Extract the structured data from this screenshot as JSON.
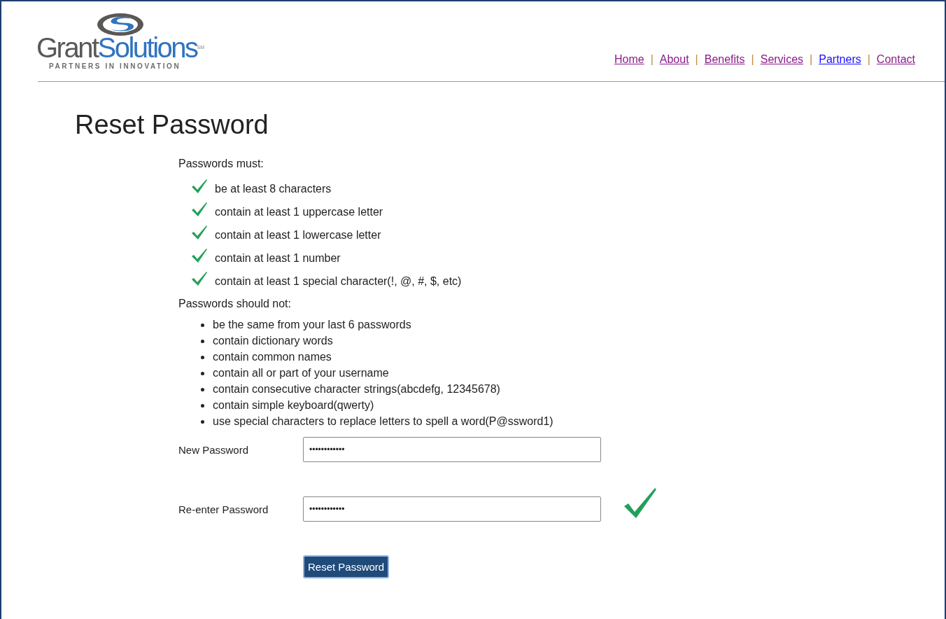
{
  "logo": {
    "name_first": "Grant",
    "name_second": "Solutions",
    "mark": "SM",
    "tagline": "PARTNERS IN INNOVATION"
  },
  "nav": [
    {
      "label": "Home",
      "visited": true
    },
    {
      "label": "About",
      "visited": true
    },
    {
      "label": "Benefits",
      "visited": true
    },
    {
      "label": "Services",
      "visited": true
    },
    {
      "label": "Partners",
      "visited": false
    },
    {
      "label": "Contact",
      "visited": true
    }
  ],
  "nav_separator": "|",
  "title": "Reset Password",
  "must_heading": "Passwords must:",
  "requirements": [
    {
      "text": "be at least 8 characters",
      "met": true
    },
    {
      "text": "contain at least 1 uppercase letter",
      "met": true
    },
    {
      "text": "contain at least 1 lowercase letter",
      "met": true
    },
    {
      "text": "contain at least 1 number",
      "met": true
    },
    {
      "text": "contain at least 1 special character(!, @, #, $, etc)",
      "met": true
    }
  ],
  "should_not_heading": "Passwords should not:",
  "should_not": [
    "be the same from your last 6 passwords",
    "contain dictionary words",
    "contain common names",
    "contain all or part of your username",
    "contain consecutive character strings(abcdefg, 12345678)",
    "contain simple keyboard(qwerty)",
    "use special characters to replace letters to spell a word(P@ssword1)"
  ],
  "fields": [
    {
      "label": "New Password",
      "value": "••••••••••••",
      "matched": false
    },
    {
      "label": "Re-enter Password",
      "value": "••••••••••••",
      "matched": true
    }
  ],
  "submit": "Reset Password"
}
